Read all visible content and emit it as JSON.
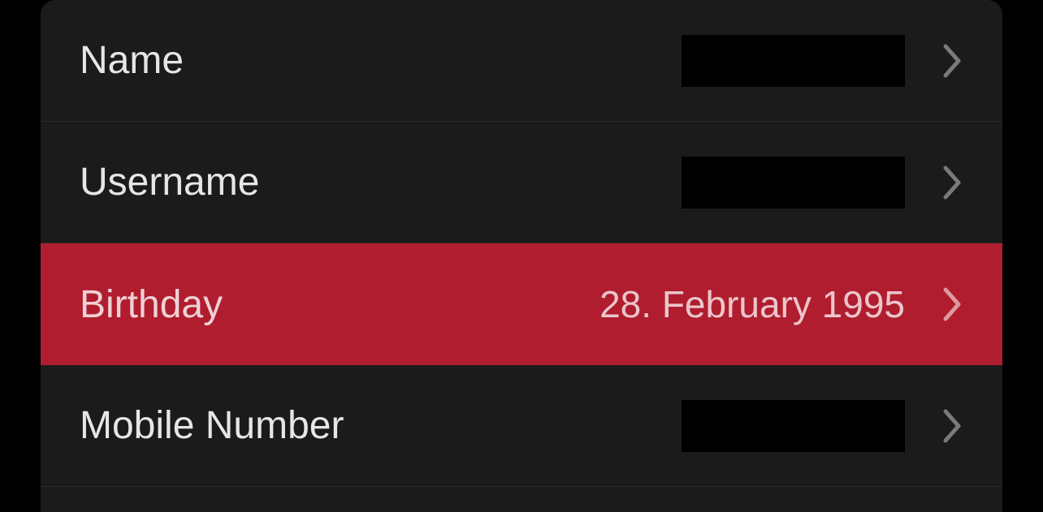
{
  "rows": [
    {
      "label": "Name",
      "value": "",
      "redacted": true,
      "highlighted": false
    },
    {
      "label": "Username",
      "value": "",
      "redacted": true,
      "highlighted": false
    },
    {
      "label": "Birthday",
      "value": "28. February 1995",
      "redacted": false,
      "highlighted": true
    },
    {
      "label": "Mobile Number",
      "value": "",
      "redacted": true,
      "highlighted": false
    }
  ]
}
